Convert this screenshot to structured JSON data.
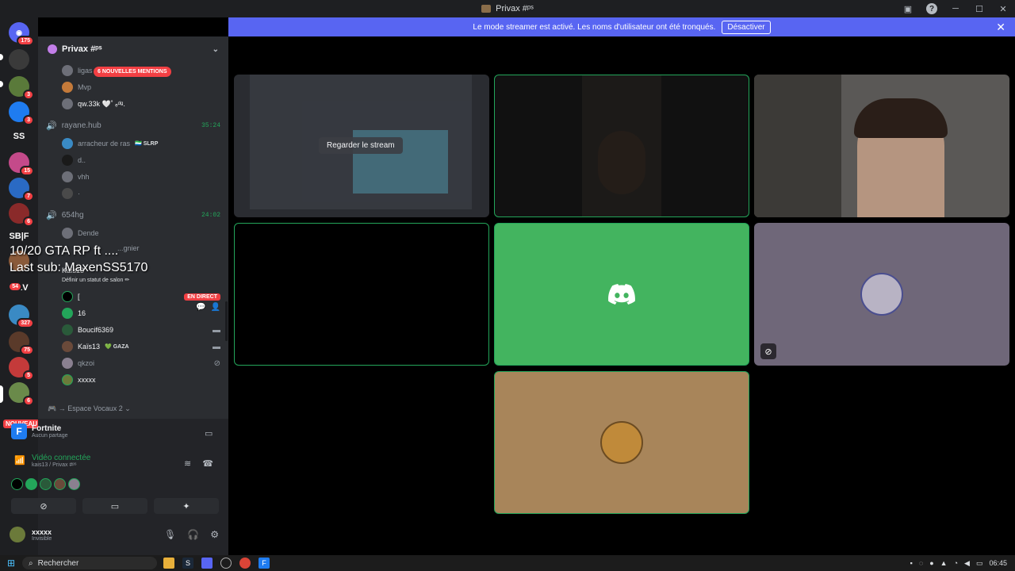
{
  "titlebar": {
    "title": "Privax #ᵖˢ"
  },
  "banner": {
    "text": "Le mode streamer est activé. Les noms d'utilisateur ont été tronqués.",
    "button": "Désactiver"
  },
  "servers": {
    "items": [
      {
        "badge": "175",
        "color": "#5865f2"
      },
      {
        "badge": "",
        "color": "#3a3a3a"
      },
      {
        "badge": "3",
        "color": "#5a7a3a"
      },
      {
        "badge": "3",
        "color": "#1f7cf0"
      },
      {
        "label": "SS",
        "badge": ""
      },
      {
        "badge": "15",
        "color": "#c44a8a"
      },
      {
        "badge": "7",
        "color": "#2a6ac4"
      },
      {
        "badge": "6",
        "color": "#8a2a2a"
      },
      {
        "label": "SB|F",
        "badge": ""
      },
      {
        "badge": "",
        "color": "#8a5a3a"
      },
      {
        "label": "B&V",
        "badge": "54"
      },
      {
        "badge": "327",
        "color": "#3a8ac4"
      },
      {
        "badge": "75",
        "color": "#5a3a2a"
      },
      {
        "badge": "5",
        "color": "#c43a3a"
      },
      {
        "badge": "6",
        "color": "#6a8a4a"
      }
    ],
    "nouveau": "NOUVEAU"
  },
  "channels": {
    "server_name": "Privax #ᵖˢ",
    "mentions": "6 NOUVELLES MENTIONS",
    "top_users": [
      "ligas",
      "Mvp",
      "qw.33k 🤍˚ ₑᵈᵍ."
    ],
    "voice": [
      {
        "name": "rayane.hub",
        "timer": "35:24",
        "users": [
          {
            "name": "arracheur de ras",
            "tag": "🇸🇱 SLRP"
          },
          {
            "name": "d..",
            "tag": ""
          },
          {
            "name": "vhh",
            "tag": ""
          },
          {
            "name": "·",
            "tag": ""
          }
        ]
      },
      {
        "name": "654hg",
        "timer": "24:02",
        "users": [
          {
            "name": "Dende",
            "tag": ""
          },
          {
            "name": "...gnier",
            "tag": ""
          }
        ]
      }
    ],
    "current_channel": "Kaïs13",
    "set_status": "Définir un statut de salon ✏",
    "current_users": [
      {
        "name": "[",
        "live": "EN DIRECT",
        "icon": ""
      },
      {
        "name": "16",
        "live": "",
        "icon": ""
      },
      {
        "name": "Boucif6369",
        "live": "",
        "icon": "📹"
      },
      {
        "name": "Kaïs13",
        "tag": "💚 GAZA",
        "live": "",
        "icon": "📹"
      },
      {
        "name": "qkzoi",
        "live": "",
        "icon": "🔇"
      },
      {
        "name": "xxxxx",
        "live": "",
        "icon": ""
      }
    ],
    "espace": "🎮 → Espace Vocaux 2 ⌄"
  },
  "overlay": {
    "line1": "10/20 GTA RP ft ....",
    "line2": "Last sub: MaxenSS5170"
  },
  "panel": {
    "activity_name": "Fortnite",
    "activity_sub": "Aucun partage",
    "video_status": "Vidéo connectée",
    "video_sub": "kais13 / Privax #ᵖˢ",
    "user_name": "xxxxx",
    "user_status": "Invisible"
  },
  "stage": {
    "watch_stream": "Regarder le stream"
  },
  "taskbar": {
    "search": "Rechercher",
    "time": "06:45"
  }
}
